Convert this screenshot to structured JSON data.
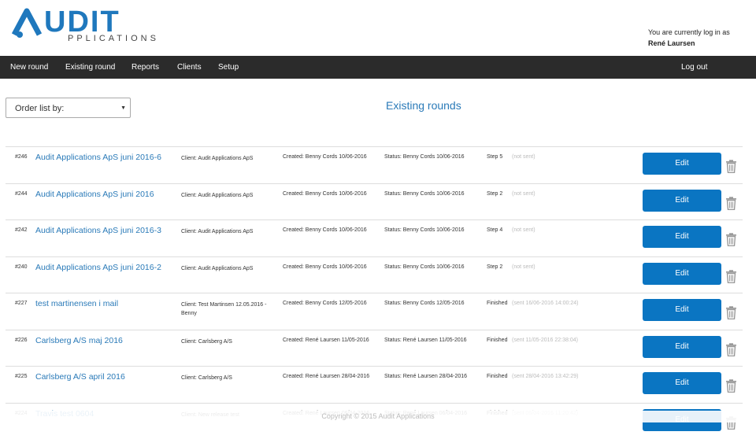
{
  "brand": {
    "logo_text": "AUDIT",
    "logo_sub": "PPLICATIONS",
    "accent": "#1f78bd"
  },
  "user": {
    "login_text": "You are currently log in as",
    "name": "René Laursen"
  },
  "nav": {
    "new_round": "New round",
    "existing_round": "Existing round",
    "reports": "Reports",
    "clients": "Clients",
    "setup": "Setup",
    "logout": "Log out"
  },
  "toolbar": {
    "order_label": "Order list by:",
    "page_title": "Existing rounds"
  },
  "rounds": [
    {
      "id": "#246",
      "title": "Audit Applications ApS juni 2016-6",
      "client": "Client: Audit Applications ApS",
      "created": "Created: Benny Cords 10/06-2016",
      "status": "Status: Benny Cords 10/06-2016",
      "step": "Step 5",
      "sent": "(not sent)",
      "edit": "Edit"
    },
    {
      "id": "#244",
      "title": "Audit Applications ApS juni 2016",
      "client": "Client: Audit Applications ApS",
      "created": "Created: Benny Cords 10/06-2016",
      "status": "Status: Benny Cords 10/06-2016",
      "step": "Step 2",
      "sent": "(not sent)",
      "edit": "Edit"
    },
    {
      "id": "#242",
      "title": "Audit Applications ApS juni 2016-3",
      "client": "Client: Audit Applications ApS",
      "created": "Created: Benny Cords 10/06-2016",
      "status": "Status: Benny Cords 10/06-2016",
      "step": "Step 4",
      "sent": "(not sent)",
      "edit": "Edit"
    },
    {
      "id": "#240",
      "title": "Audit Applications ApS juni 2016-2",
      "client": "Client: Audit Applications ApS",
      "created": "Created: Benny Cords 10/06-2016",
      "status": "Status: Benny Cords 10/06-2016",
      "step": "Step 2",
      "sent": "(not sent)",
      "edit": "Edit"
    },
    {
      "id": "#227",
      "title": "test martinensen i mail",
      "client": "Client: Test Martinsen 12.05.2016 - Benny",
      "created": "Created: Benny Cords 12/05-2016",
      "status": "Status: Benny Cords 12/05-2016",
      "step": "Finished",
      "sent": "(sent 16/06-2016 14:00:24)",
      "edit": "Edit"
    },
    {
      "id": "#226",
      "title": "Carlsberg A/S maj 2016",
      "client": "Client: Carlsberg A/S",
      "created": "Created: René Laursen 11/05-2016",
      "status": "Status: René Laursen 11/05-2016",
      "step": "Finished",
      "sent": "(sent 11/05-2016 22:38:04)",
      "edit": "Edit"
    },
    {
      "id": "#225",
      "title": "Carlsberg A/S april 2016",
      "client": "Client: Carlsberg A/S",
      "created": "Created: René Laursen 28/04-2016",
      "status": "Status: René Laursen 28/04-2016",
      "step": "Finished",
      "sent": "(sent 28/04-2016 13:42:29)",
      "edit": "Edit"
    },
    {
      "id": "#224",
      "title": "Travis test 0604",
      "client": "Client: New release test",
      "created": "Created: René Laursen 06/04-2016",
      "status": "Status: René Laursen 06/04-2016",
      "step": "Finished",
      "sent": "(sent 06/04-2016 11:20:42)",
      "edit": "Edit"
    }
  ],
  "footer": {
    "text": "Copyright © 2015 Audit Applications"
  }
}
